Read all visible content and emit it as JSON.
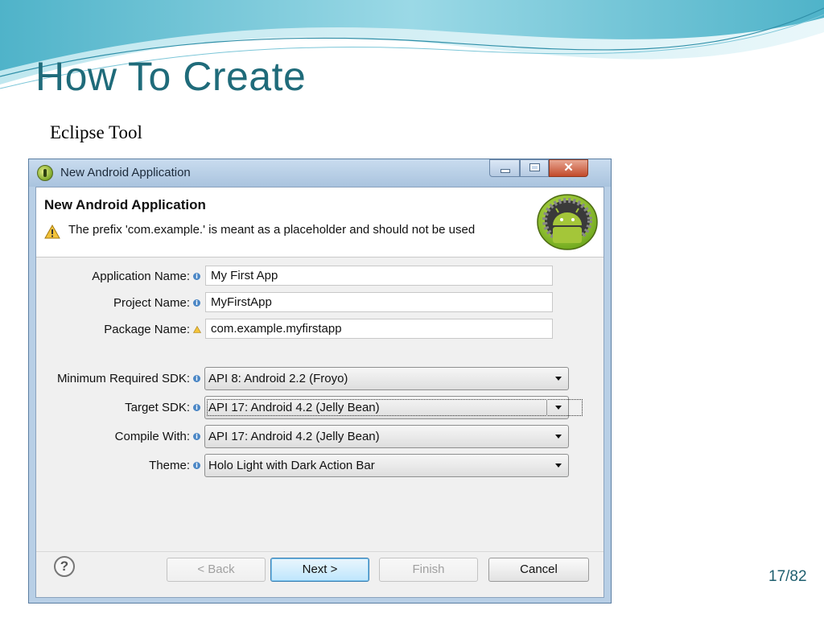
{
  "slide": {
    "title": "How To Create",
    "subtitle": "Eclipse Tool",
    "page_number": "17/82"
  },
  "dialog": {
    "window_title": "New Android Application",
    "window_icon": "eclipse-adt-icon",
    "banner": {
      "title": "New Android Application",
      "message": "The prefix 'com.example.' is meant as a placeholder and should not be used",
      "message_icon": "warning-icon",
      "logo": "android-logo"
    },
    "fields": {
      "app_name": {
        "label": "Application Name:",
        "value": "My First App",
        "hint_icon": "info-icon"
      },
      "project_name": {
        "label": "Project Name:",
        "value": "MyFirstApp",
        "hint_icon": "info-icon"
      },
      "package_name": {
        "label": "Package Name:",
        "value": "com.example.myfirstapp",
        "hint_icon": "warning-icon"
      }
    },
    "selects": {
      "min_sdk": {
        "label": "Minimum Required SDK:",
        "value": "API 8: Android 2.2 (Froyo)"
      },
      "target_sdk": {
        "label": "Target SDK:",
        "value": "API 17: Android 4.2 (Jelly Bean)"
      },
      "compile_with": {
        "label": "Compile With:",
        "value": "API 17: Android 4.2 (Jelly Bean)"
      },
      "theme": {
        "label": "Theme:",
        "value": "Holo Light with Dark Action Bar"
      }
    },
    "buttons": {
      "back": "< Back",
      "next": "Next >",
      "finish": "Finish",
      "cancel": "Cancel"
    },
    "help_icon_glyph": "?"
  },
  "colors": {
    "title": "#1f6b7a",
    "window_frame": "#b8cfe6",
    "default_button": "#bee6fd"
  }
}
